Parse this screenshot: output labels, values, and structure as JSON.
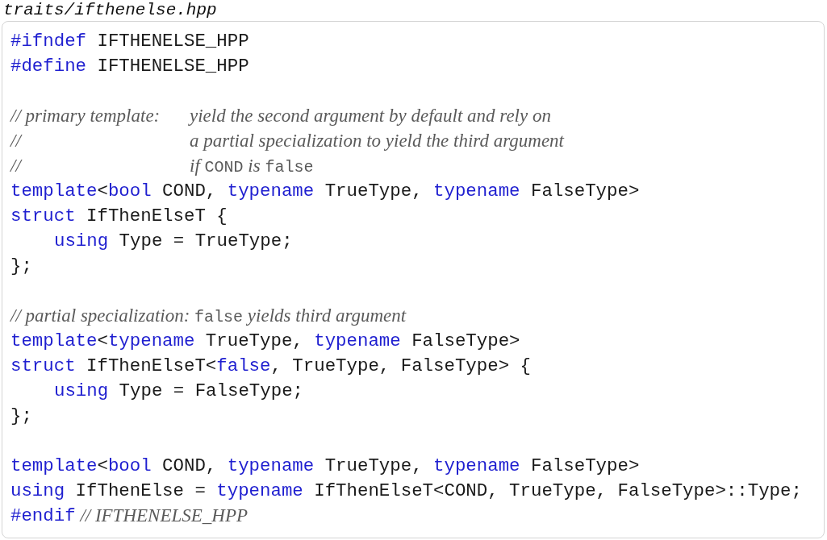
{
  "filename": "traits/ifthenelse.hpp",
  "lines": [
    {
      "gap_before": false,
      "segments": [
        {
          "kind": "keyword",
          "text": "#ifndef"
        },
        {
          "kind": "plain",
          "text": " IFTHENELSE_HPP"
        }
      ]
    },
    {
      "gap_before": false,
      "segments": [
        {
          "kind": "keyword",
          "text": "#define"
        },
        {
          "kind": "plain",
          "text": " IFTHENELSE_HPP"
        }
      ]
    },
    {
      "gap_before": true,
      "hanging": true,
      "segments": [
        {
          "kind": "comment",
          "text": "// primary template:"
        },
        {
          "kind": "comment",
          "text": "yield the second argument by default and rely on"
        }
      ]
    },
    {
      "gap_before": false,
      "hanging": true,
      "segments": [
        {
          "kind": "comment",
          "text": "//"
        },
        {
          "kind": "comment",
          "text": "a partial specialization to yield the third argument"
        }
      ]
    },
    {
      "gap_before": false,
      "hanging": true,
      "segments": [
        {
          "kind": "comment",
          "text": "//"
        },
        {
          "kind": "comment",
          "text": "if "
        },
        {
          "kind": "comment_code",
          "text": "COND"
        },
        {
          "kind": "comment",
          "text": " is "
        },
        {
          "kind": "comment_code",
          "text": "false"
        }
      ]
    },
    {
      "gap_before": false,
      "segments": [
        {
          "kind": "keyword",
          "text": "template"
        },
        {
          "kind": "plain",
          "text": "<"
        },
        {
          "kind": "keyword",
          "text": "bool"
        },
        {
          "kind": "plain",
          "text": " COND, "
        },
        {
          "kind": "keyword",
          "text": "typename"
        },
        {
          "kind": "plain",
          "text": " TrueType, "
        },
        {
          "kind": "keyword",
          "text": "typename"
        },
        {
          "kind": "plain",
          "text": " FalseType>"
        }
      ]
    },
    {
      "gap_before": false,
      "segments": [
        {
          "kind": "keyword",
          "text": "struct"
        },
        {
          "kind": "plain",
          "text": " IfThenElseT {"
        }
      ]
    },
    {
      "gap_before": false,
      "indented": true,
      "segments": [
        {
          "kind": "keyword",
          "text": "using"
        },
        {
          "kind": "plain",
          "text": " Type = TrueType;"
        }
      ]
    },
    {
      "gap_before": false,
      "segments": [
        {
          "kind": "plain",
          "text": "};"
        }
      ]
    },
    {
      "gap_before": true,
      "hanging": false,
      "segments": [
        {
          "kind": "comment",
          "text": "// partial specialization: "
        },
        {
          "kind": "comment_code",
          "text": "false"
        },
        {
          "kind": "comment",
          "text": " yields third argument"
        }
      ]
    },
    {
      "gap_before": false,
      "segments": [
        {
          "kind": "keyword",
          "text": "template"
        },
        {
          "kind": "plain",
          "text": "<"
        },
        {
          "kind": "keyword",
          "text": "typename"
        },
        {
          "kind": "plain",
          "text": " TrueType, "
        },
        {
          "kind": "keyword",
          "text": "typename"
        },
        {
          "kind": "plain",
          "text": " FalseType>"
        }
      ]
    },
    {
      "gap_before": false,
      "segments": [
        {
          "kind": "keyword",
          "text": "struct"
        },
        {
          "kind": "plain",
          "text": " IfThenElseT<"
        },
        {
          "kind": "keyword",
          "text": "false"
        },
        {
          "kind": "plain",
          "text": ", TrueType, FalseType> {"
        }
      ]
    },
    {
      "gap_before": false,
      "indented": true,
      "segments": [
        {
          "kind": "keyword",
          "text": "using"
        },
        {
          "kind": "plain",
          "text": " Type = FalseType;"
        }
      ]
    },
    {
      "gap_before": false,
      "segments": [
        {
          "kind": "plain",
          "text": "};"
        }
      ]
    },
    {
      "gap_before": true,
      "segments": [
        {
          "kind": "keyword",
          "text": "template"
        },
        {
          "kind": "plain",
          "text": "<"
        },
        {
          "kind": "keyword",
          "text": "bool"
        },
        {
          "kind": "plain",
          "text": " COND, "
        },
        {
          "kind": "keyword",
          "text": "typename"
        },
        {
          "kind": "plain",
          "text": " TrueType, "
        },
        {
          "kind": "keyword",
          "text": "typename"
        },
        {
          "kind": "plain",
          "text": " FalseType>"
        }
      ]
    },
    {
      "gap_before": false,
      "segments": [
        {
          "kind": "keyword",
          "text": "using"
        },
        {
          "kind": "plain",
          "text": " IfThenElse = "
        },
        {
          "kind": "keyword",
          "text": "typename"
        },
        {
          "kind": "plain",
          "text": " IfThenElseT<COND, TrueType, FalseType>::Type;"
        }
      ]
    },
    {
      "gap_before": false,
      "segments": [
        {
          "kind": "keyword",
          "text": "#endif"
        },
        {
          "kind": "comment",
          "text": " // IFTHENELSE_HPP"
        }
      ]
    }
  ]
}
